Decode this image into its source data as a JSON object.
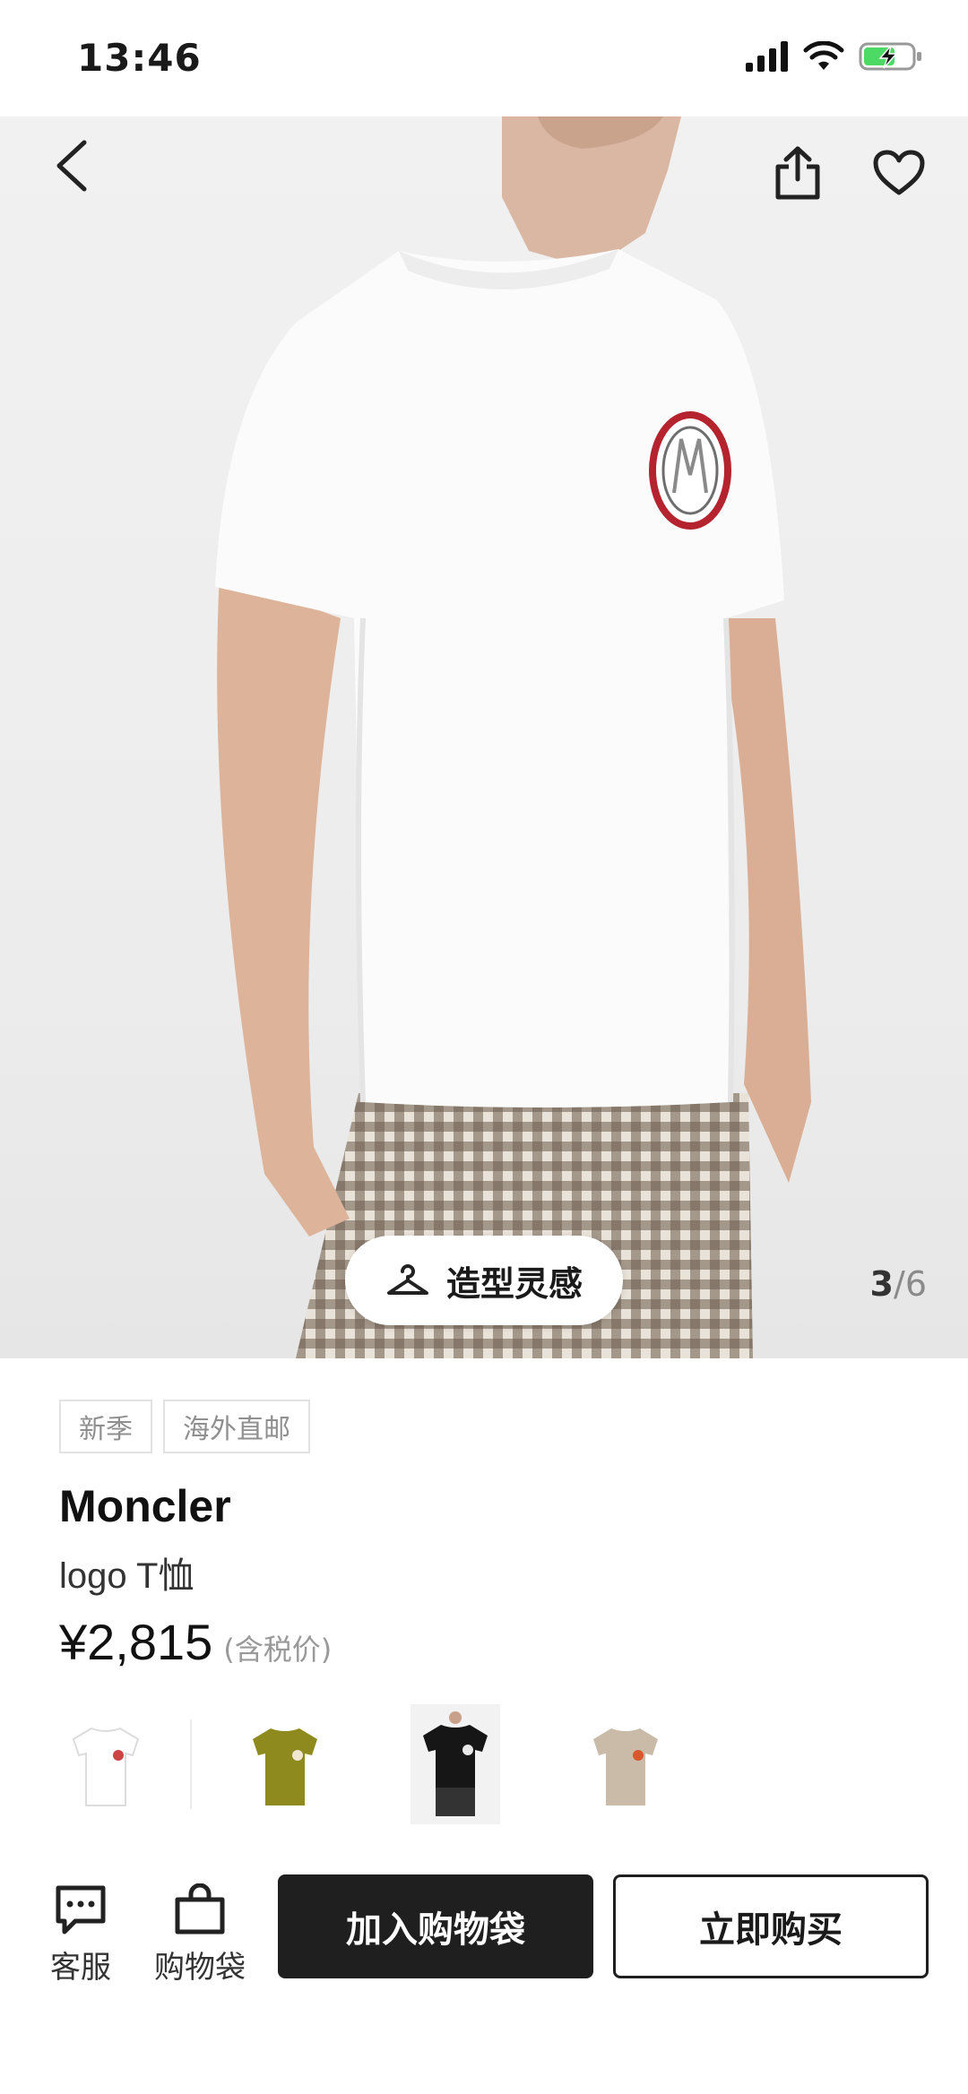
{
  "status_bar": {
    "time": "13:46",
    "icons": [
      "signal-icon",
      "wifi-icon",
      "battery-charging-icon"
    ]
  },
  "gallery": {
    "current": "3",
    "separator": "/",
    "total": "6",
    "style_button_label": "造型灵感",
    "icons": [
      "back-icon",
      "share-icon",
      "heart-icon",
      "hanger-icon"
    ]
  },
  "product": {
    "tags": [
      "新季",
      "海外直邮"
    ],
    "brand": "Moncler",
    "name": "logo T恤",
    "price": "¥2,815",
    "price_note": "(含税价)",
    "variants": [
      {
        "color": "#ffffff",
        "selected": false
      },
      {
        "color": "#8f8a1e",
        "selected": false
      },
      {
        "color": "#161616",
        "selected": true
      },
      {
        "color": "#c9bba8",
        "selected": false
      }
    ]
  },
  "bottom_bar": {
    "customer_service_label": "客服",
    "bag_label": "购物袋",
    "add_to_bag_label": "加入购物袋",
    "buy_now_label": "立即购买"
  },
  "colors": {
    "primary_button": "#1f1f1f",
    "battery_green": "#4cd964"
  }
}
